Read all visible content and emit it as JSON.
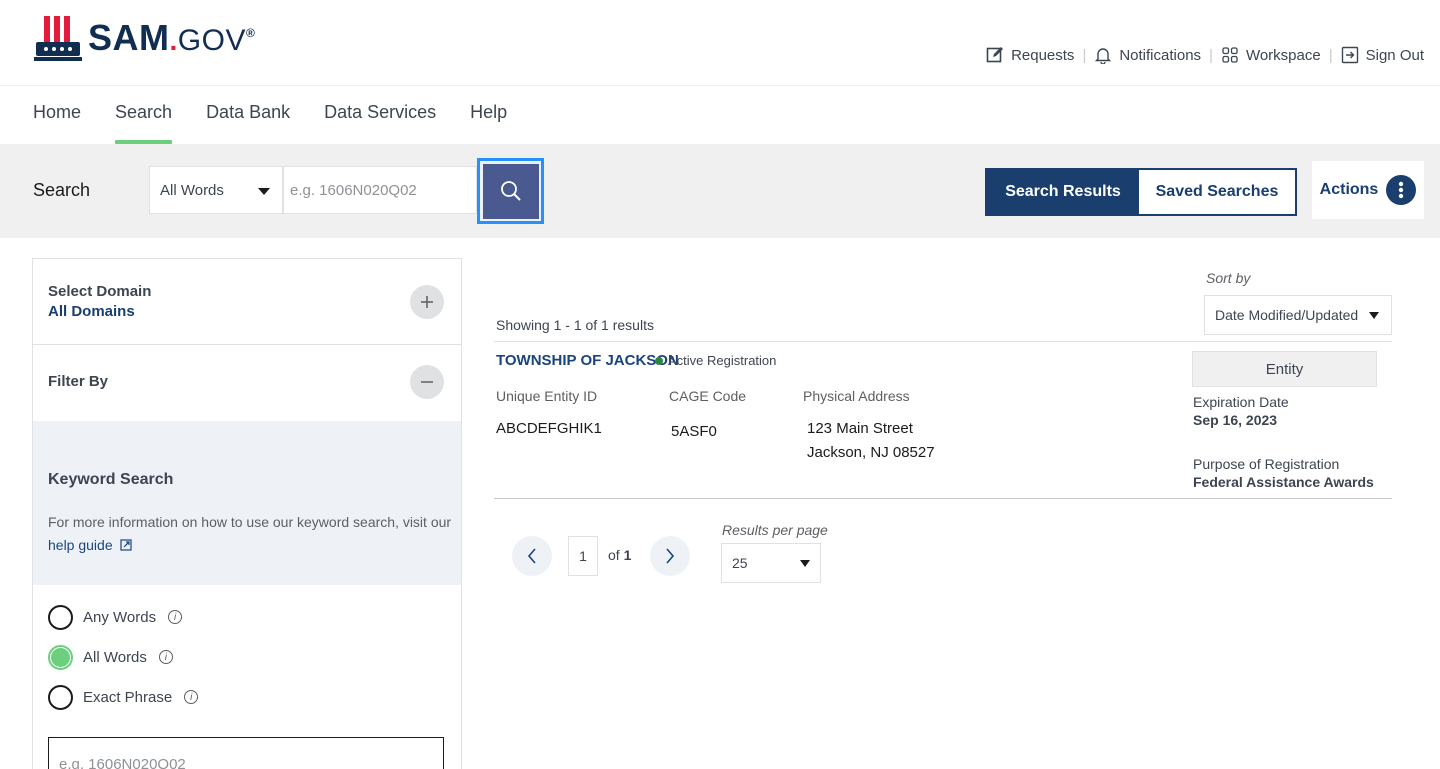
{
  "brand": {
    "logo_text": "SAM",
    "logo_dot": ".",
    "logo_gov": "GOV",
    "logo_reg": "®",
    "icon": "uncle-sam-hat-icon"
  },
  "util_nav": [
    {
      "label": "Requests",
      "icon": "edit-icon"
    },
    {
      "label": "Notifications",
      "icon": "bell-icon"
    },
    {
      "label": "Workspace",
      "icon": "grid-icon"
    },
    {
      "label": "Sign Out",
      "icon": "sign-out-icon"
    }
  ],
  "main_nav": {
    "items": [
      "Home",
      "Search",
      "Data Bank",
      "Data Services",
      "Help"
    ],
    "active": "Search"
  },
  "search": {
    "label": "Search",
    "mode": "All Words",
    "placeholder": "e.g. 1606N020Q02",
    "toggle_on": "Search Results",
    "toggle_off": "Saved Searches",
    "actions": "Actions"
  },
  "sidebar": {
    "domain_title": "Select Domain",
    "domain_value": "All Domains",
    "filter_title": "Filter By",
    "keyword_title": "Keyword Search",
    "keyword_info": "For more information on how to use our keyword search, visit our",
    "help_link": "help guide",
    "radios": [
      {
        "label": "Any Words",
        "checked": false
      },
      {
        "label": "All Words",
        "checked": true
      },
      {
        "label": "Exact Phrase",
        "checked": false
      }
    ],
    "keyword_placeholder": "e.g. 1606N020Q02"
  },
  "results": {
    "sort_label": "Sort by",
    "sort_value": "Date Modified/Updated",
    "showing": "Showing 1 - 1 of 1 results",
    "item": {
      "name": "TOWNSHIP OF JACKSON",
      "status": "Active Registration",
      "uei_label": "Unique Entity ID",
      "uei_value": "ABCDEFGHIK1",
      "cage_label": "CAGE Code",
      "cage_value": "5ASF0",
      "address_label": "Physical Address",
      "address_line1": "123 Main Street",
      "address_line2": "Jackson, NJ  08527",
      "type": "Entity",
      "expiration_label": "Expiration Date",
      "expiration_value": "Sep 16, 2023",
      "purpose_label": "Purpose of Registration",
      "purpose_value": "Federal Assistance Awards"
    },
    "pagination": {
      "page": "1",
      "of_text": "of",
      "total": "1",
      "rpp_label": "Results per page",
      "rpp_value": "25"
    }
  },
  "colors": {
    "navy": "#1a3e6e",
    "accent_green": "#6ccf7e",
    "status_green": "#2e8540",
    "search_button": "#4a5a91",
    "focus_blue": "#2491ff"
  }
}
